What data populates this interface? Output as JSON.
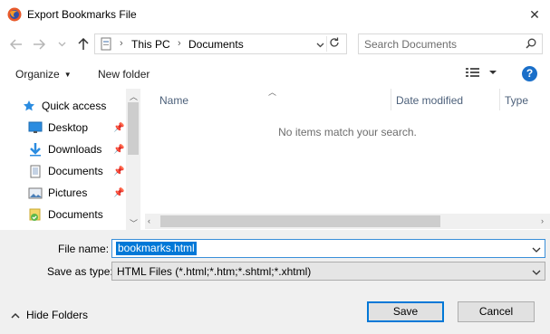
{
  "window": {
    "title": "Export Bookmarks File",
    "close_glyph": "✕"
  },
  "nav": {
    "back_icon": "back-arrow-icon",
    "forward_icon": "forward-arrow-icon",
    "recent_icon": "chevron-down-icon",
    "up_icon": "up-arrow-icon"
  },
  "address": {
    "crumbs": [
      "This PC",
      "Documents"
    ],
    "separator": "›"
  },
  "search": {
    "placeholder": "Search Documents"
  },
  "toolbar": {
    "organize": "Organize",
    "new_folder": "New folder",
    "help": "?"
  },
  "sidebar": {
    "items": [
      {
        "label": "Quick access",
        "icon": "star-icon",
        "pinned": false
      },
      {
        "label": "Desktop",
        "icon": "desktop-icon",
        "pinned": true
      },
      {
        "label": "Downloads",
        "icon": "download-icon",
        "pinned": true
      },
      {
        "label": "Documents",
        "icon": "document-icon",
        "pinned": true
      },
      {
        "label": "Pictures",
        "icon": "pictures-icon",
        "pinned": true
      },
      {
        "label": "Documents",
        "icon": "documents-library-icon",
        "pinned": false
      }
    ]
  },
  "columns": [
    "Name",
    "Date modified",
    "Type"
  ],
  "file_list": {
    "empty_message": "No items match your search."
  },
  "form": {
    "file_name_label": "File name:",
    "file_name_value": "bookmarks.html",
    "save_as_type_label": "Save as type:",
    "save_as_type_value": "HTML Files (*.html;*.htm;*.shtml;*.xhtml)"
  },
  "footer": {
    "hide_folders": "Hide Folders",
    "save": "Save",
    "cancel": "Cancel"
  },
  "colors": {
    "accent": "#0078d7",
    "help": "#1a6fc9",
    "pane_bg": "#f0f0f0"
  }
}
